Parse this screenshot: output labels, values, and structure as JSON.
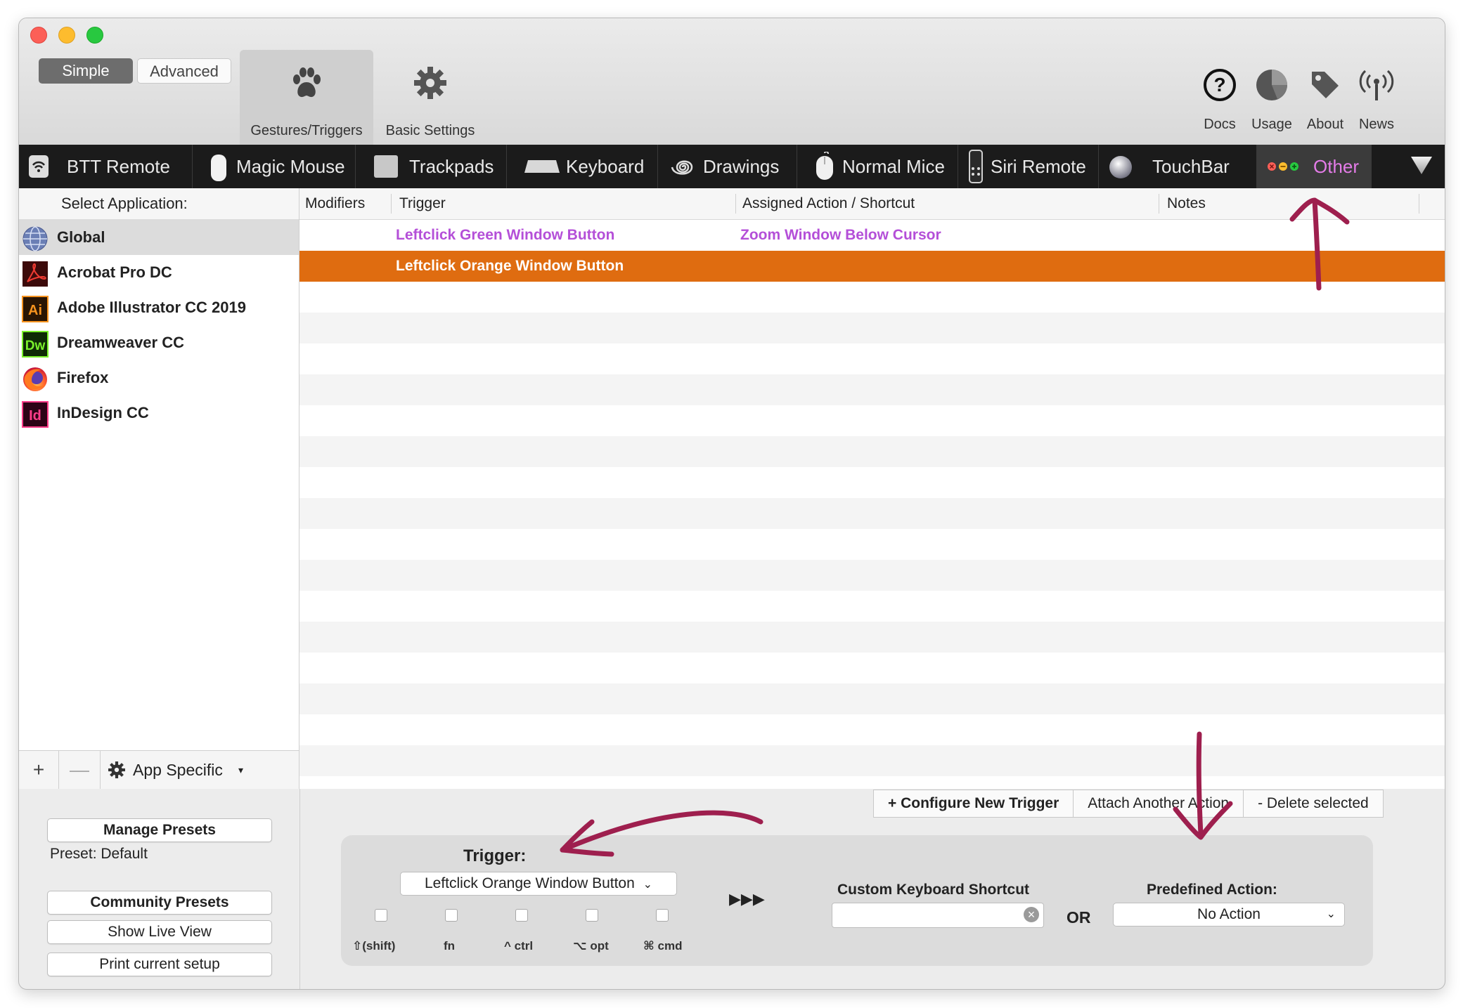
{
  "toolbar": {
    "mode_simple": "Simple",
    "mode_advanced": "Advanced",
    "gestures_label": "Gestures/Triggers",
    "basic_settings_label": "Basic Settings",
    "docs_label": "Docs",
    "usage_label": "Usage",
    "about_label": "About",
    "news_label": "News"
  },
  "device_tabs": [
    {
      "label": "BTT Remote",
      "icon": "wifi-phone-icon"
    },
    {
      "label": "Magic Mouse",
      "icon": "magic-mouse-icon"
    },
    {
      "label": "Trackpads",
      "icon": "trackpad-icon"
    },
    {
      "label": "Keyboard",
      "icon": "keyboard-icon"
    },
    {
      "label": "Drawings",
      "icon": "spiral-icon"
    },
    {
      "label": "Normal Mice",
      "icon": "mouse-icon"
    },
    {
      "label": "Siri Remote",
      "icon": "remote-icon"
    },
    {
      "label": "TouchBar",
      "icon": "touchbar-icon"
    },
    {
      "label": "Other",
      "icon": "window-buttons-icon"
    }
  ],
  "sidebar": {
    "header": "Select Application:",
    "apps": [
      {
        "name": "Global",
        "icon": "globe-icon",
        "selected": true
      },
      {
        "name": "Acrobat Pro DC",
        "icon": "acrobat-icon"
      },
      {
        "name": "Adobe Illustrator CC 2019",
        "icon": "illustrator-icon",
        "badge": "Ai"
      },
      {
        "name": "Dreamweaver CC",
        "icon": "dreamweaver-icon",
        "badge": "Dw"
      },
      {
        "name": "Firefox",
        "icon": "firefox-icon"
      },
      {
        "name": "InDesign CC",
        "icon": "indesign-icon",
        "badge": "Id"
      }
    ],
    "footer": {
      "add": "+",
      "remove": "—",
      "app_specific": "App Specific"
    }
  },
  "table": {
    "columns": [
      "Modifiers",
      "Trigger",
      "Assigned Action / Shortcut",
      "Notes"
    ],
    "rows": [
      {
        "modifiers": "",
        "trigger": "Leftclick Green Window Button",
        "action": "Zoom Window Below Cursor",
        "notes": ""
      },
      {
        "modifiers": "",
        "trigger": "Leftclick Orange Window Button",
        "action": "",
        "notes": "",
        "selected": true
      }
    ]
  },
  "actions": {
    "configure": "+ Configure New Trigger",
    "attach": "Attach Another Action",
    "delete": "- Delete selected"
  },
  "presets": {
    "manage": "Manage Presets",
    "current": "Preset: Default",
    "community": "Community Presets",
    "live_view": "Show Live View",
    "print": "Print current setup"
  },
  "trigger_panel": {
    "trigger_title": "Trigger:",
    "trigger_value": "Leftclick Orange Window Button",
    "modifiers": [
      "⇧(shift)",
      "fn",
      "^ ctrl",
      "⌥ opt",
      "⌘ cmd"
    ],
    "arrows": "▶▶▶",
    "shortcut_title": "Custom Keyboard Shortcut",
    "or_label": "OR",
    "predefined_title": "Predefined Action:",
    "predefined_value": "No Action"
  },
  "colors": {
    "selection_orange": "#df6c10",
    "trigger_purple": "#b44fd8",
    "annotation_arrow": "#9e1f4e",
    "tabbar": "#1b1b1b"
  }
}
